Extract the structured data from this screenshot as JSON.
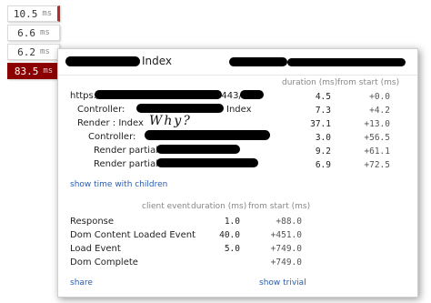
{
  "badges": [
    {
      "value": "10.5",
      "unit": "ms"
    },
    {
      "value": "6.6",
      "unit": "ms"
    },
    {
      "value": "6.2",
      "unit": "ms"
    },
    {
      "value": "83.5",
      "unit": "ms"
    }
  ],
  "popup": {
    "title_suffix": "Index",
    "columns": {
      "duration": "duration (ms)",
      "from_start": "from start (ms)"
    },
    "rows": [
      {
        "label": "https://",
        "label_tail": ":443/",
        "duration": "4.5",
        "from_start": "+0.0"
      },
      {
        "label": "Controller:",
        "label_tail": "Index",
        "duration": "7.3",
        "from_start": "+4.2"
      },
      {
        "label": "Render : Index",
        "label_tail": "",
        "duration": "37.1",
        "from_start": "+13.0"
      },
      {
        "label": "Controller:",
        "label_tail": "",
        "duration": "3.0",
        "from_start": "+56.5"
      },
      {
        "label": "Render partial:",
        "label_tail": "",
        "duration": "9.2",
        "from_start": "+61.1"
      },
      {
        "label": "Render partial:",
        "label_tail": "",
        "duration": "6.9",
        "from_start": "+72.5"
      }
    ],
    "annotation": "Why?",
    "show_time_link": "show time with children",
    "client": {
      "columns": {
        "event": "client event",
        "duration": "duration (ms)",
        "from_start": "from start (ms)"
      },
      "rows": [
        {
          "label": "Response",
          "duration": "1.0",
          "from_start": "+88.0"
        },
        {
          "label": "Dom Content Loaded Event",
          "duration": "40.0",
          "from_start": "+451.0"
        },
        {
          "label": "Load Event",
          "duration": "5.0",
          "from_start": "+749.0"
        },
        {
          "label": "Dom Complete",
          "duration": "",
          "from_start": "+749.0"
        }
      ]
    },
    "share_link": "share",
    "trivial_link": "show trivial"
  }
}
